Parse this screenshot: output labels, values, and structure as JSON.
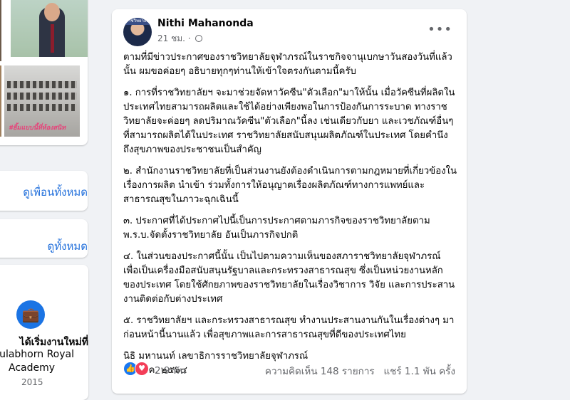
{
  "sidebar": {
    "photo_caption": "#ยิ้มแบบนี้ที่ห้องสนิท",
    "friends_link": "ดูเพื่อนทั้งหมด",
    "pages_link": "ดูทั้งหมด",
    "job": {
      "title": "ได้เริ่มงานใหม่ที่",
      "org_line1": "ulabhorn Royal",
      "org_line2": "Academy",
      "year": "2015",
      "icon": "briefcase-icon"
    }
  },
  "post": {
    "avatar_text": "ราชวิทยาลัย",
    "author": "Nithi Mahanonda",
    "time": "21 ชม.",
    "privacy_icon": "globe-icon",
    "more_label": "•••",
    "paragraphs": [
      "ตามที่มีข่าวประกาศของราชวิทยาลัยจุฬาภรณ์ในราชกิจจานุเบกษาวันสองวันที่แล้วนั้น ผมขอค่อยๆ อธิบายทุกๆท่านให้เข้าใจตรงกันตามนี้ครับ",
      "๑. การที่ราชวิทยาลัยฯ จะมาช่วยจัดหาวัคซีน\"ตัวเลือก\"มาให้นั้น เมื่อวัคซีนที่ผลิตในประเทศไทยสามารถผลิตและใช้ได้อย่างเพียงพอในการป้องกันการระบาด ทางราชวิทยาลัยจะค่อยๆ ลดปริมาณวัคซีน\"ตัวเลือก\"นี้ลง เช่นเดียวกับยา และเวชภัณฑ์อื่นๆที่สามารถผลิตได้ในประเทศ ราชวิทยาลัยสนับสนุนผลิตภัณฑ์ในประเทศ โดยคำนึงถึงสุขภาพของประชาชนเป็นสำคัญ",
      "๒. สำนักงานราชวิทยาลัยที่เป็นส่วนงานยังต้องดำเนินการตามกฎหมายที่เกี่ยวข้องในเรื่องการผลิต นำเข้า ร่วมทั้งการให้อนุญาตเรื่องผลิตภัณฑ์ทางการแพทย์และสาธารณสุขในภาวะฉุกเฉินนี้",
      "๓. ประกาศที่ได้ประกาศไปนี้เป็นการประกาศตามภารกิจของราชวิทยาลัยตาม พ.ร.บ.จัดตั้งราชวิทยาลัย อันเป็นภารกิจปกติ",
      "๔. ในส่วนของประกาศนี้นั้น เป็นไปตามความเห็นของสภาราชวิทยาลัยจุฬาภรณ์ เพื่อเป็นเครื่องมือสนับสนุนรัฐบาลและกระทรวงสาธารณสุข ซึ่งเป็นหน่วยงานหลักของประเทศ โดยใช้ศักยภาพของราชวิทยาลัยในเรื่องวิชาการ วิจัย และการประสานงานติดต่อกับต่างประเทศ",
      "๕. ราชวิทยาลัยฯ และกระทรวงสาธารณสุข ทำงานประสานงานกันในเรื่องต่างๆ มาก่อนหน้านี้นานแล้ว เพื่อสุขภาพและการสาธารณสุขที่ดีของประเทศไทย"
    ],
    "signature": "นิธิ มหานนท์ เลขาธิการราชวิทยาลัยจุฬาภรณ์",
    "date": "๒๗ พ.ค. ๒๕๖๔",
    "reaction_count": "2.9 พัน",
    "comments": "ความคิดเห็น 148 รายการ",
    "shares": "แชร์ 1.1 พัน ครั้ง"
  }
}
